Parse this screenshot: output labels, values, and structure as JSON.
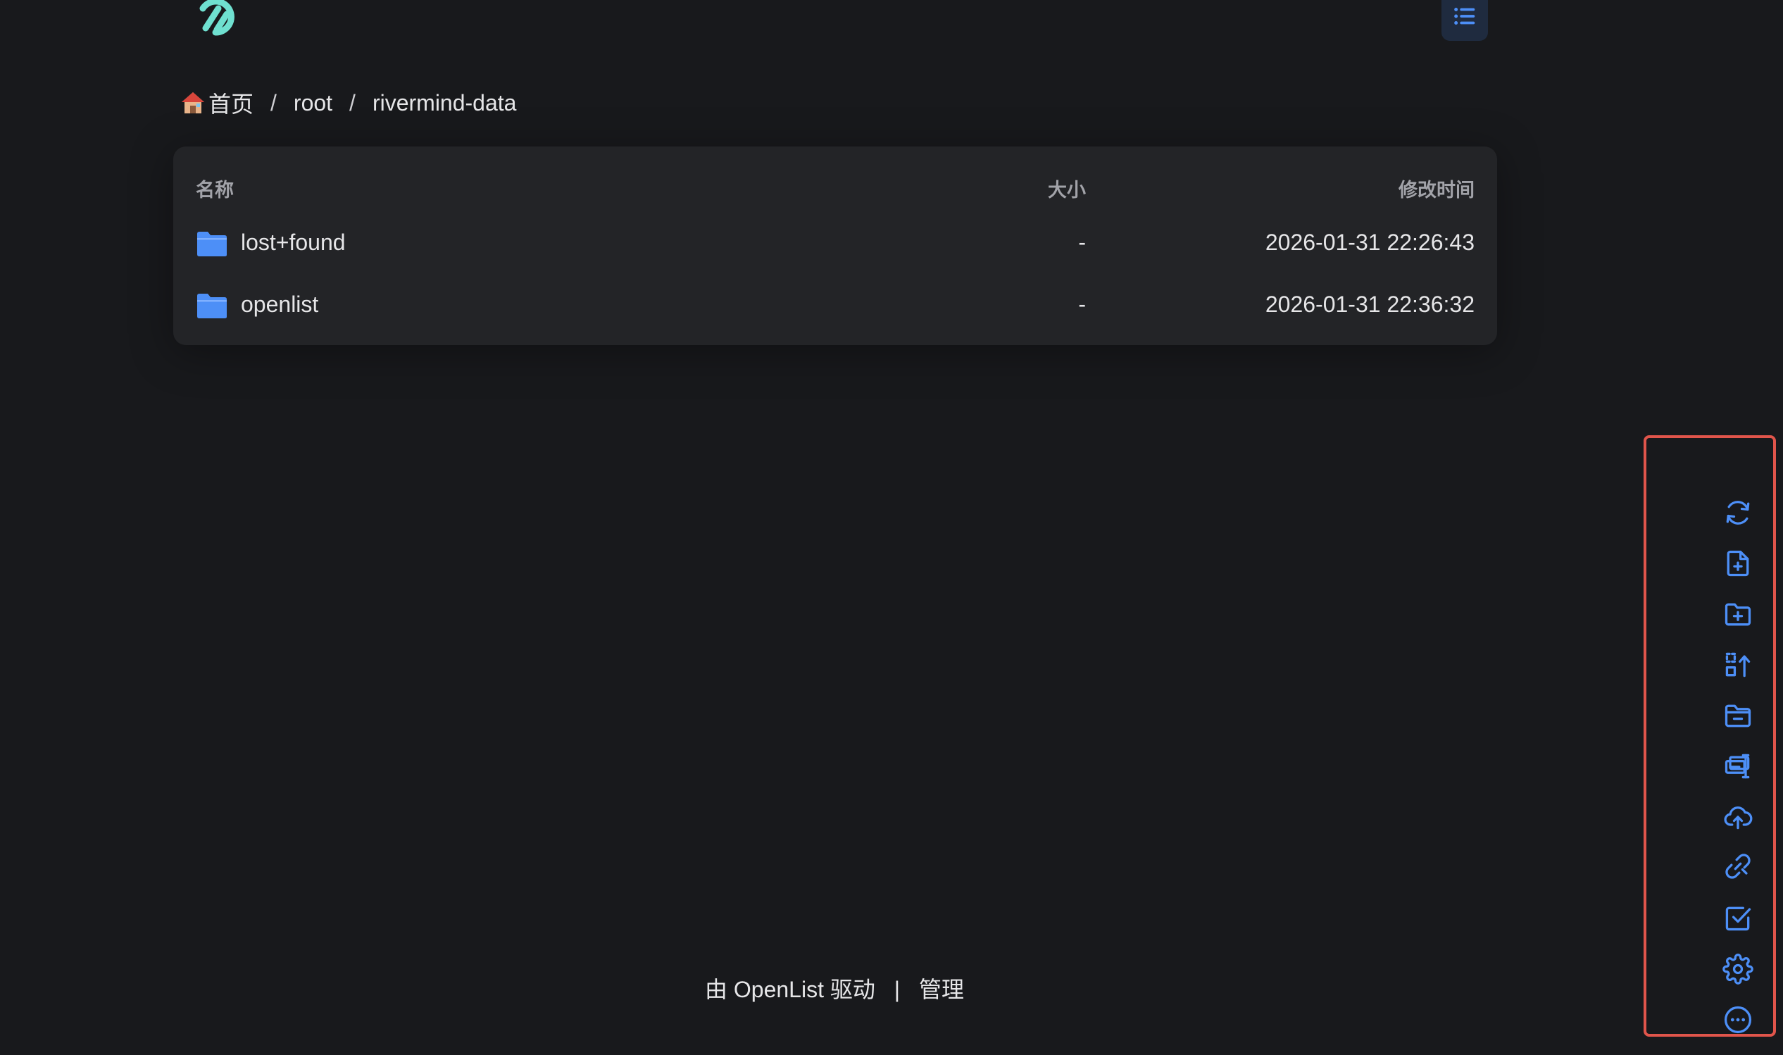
{
  "header": {
    "logo_icon": "openlist-logo-icon",
    "list_view_icon": "list-icon"
  },
  "breadcrumb": {
    "home_label": "首页",
    "separator": "/",
    "items": [
      "root",
      "rivermind-data"
    ]
  },
  "table": {
    "columns": {
      "name": "名称",
      "size": "大小",
      "modified": "修改时间"
    },
    "rows": [
      {
        "name": "lost+found",
        "size": "-",
        "modified": "2026-01-31 22:26:43",
        "icon": "folder-icon"
      },
      {
        "name": "openlist",
        "size": "-",
        "modified": "2026-01-31 22:36:32",
        "icon": "folder-icon"
      }
    ]
  },
  "footer": {
    "powered_by": "由 OpenList 驱动",
    "separator": "|",
    "manage": "管理"
  },
  "toolbar": {
    "icons": [
      "refresh-icon",
      "new-file-icon",
      "new-folder-icon",
      "recursive-move-icon",
      "remove-empty-folder-icon",
      "batch-rename-icon",
      "upload-icon",
      "offline-download-icon",
      "select-icon",
      "settings-icon",
      "more-icon"
    ]
  },
  "colors": {
    "background": "#18191c",
    "card": "#232427",
    "accent": "#4d8ff7",
    "logo": "#6fe0d0",
    "highlight_border": "#e0554b"
  }
}
